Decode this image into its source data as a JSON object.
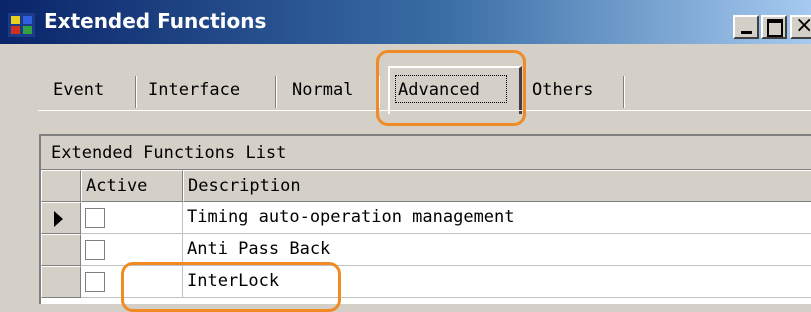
{
  "window": {
    "title": "Extended Functions",
    "icon": "app-window-icon",
    "minimize_icon": "minimize-icon",
    "maximize_icon": "maximize-icon",
    "close_label": "×"
  },
  "tabs": [
    {
      "label": "Event",
      "selected": false
    },
    {
      "label": "Interface",
      "selected": false
    },
    {
      "label": "Normal",
      "selected": false
    },
    {
      "label": "Advanced",
      "selected": true
    },
    {
      "label": "Others",
      "selected": false
    }
  ],
  "grid": {
    "caption": "Extended Functions List",
    "columns": [
      "Active",
      "Description"
    ],
    "rows": [
      {
        "active": false,
        "description": "Timing auto-operation management",
        "current": true
      },
      {
        "active": false,
        "description": "Anti Pass Back",
        "current": false
      },
      {
        "active": false,
        "description": "InterLock",
        "current": false
      }
    ],
    "current_row_icon": "row-pointer-icon"
  },
  "colors": {
    "highlight": "#f08a24",
    "titlebar_start": "#0a246a",
    "titlebar_end": "#a6caf0",
    "face": "#d4d0c8"
  }
}
